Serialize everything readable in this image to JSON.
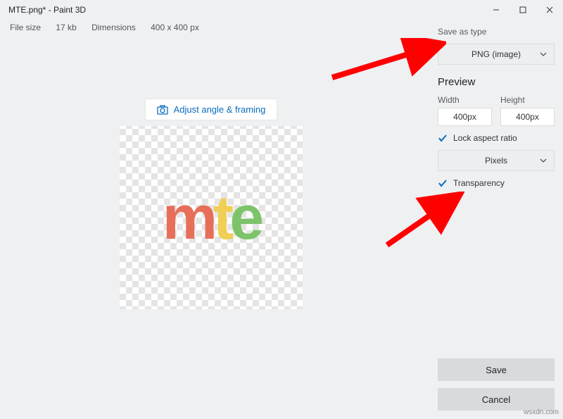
{
  "window": {
    "title": "MTE.png* - Paint 3D",
    "file_size_label": "File size",
    "file_size_value": "17 kb",
    "dimensions_label": "Dimensions",
    "dimensions_value": "400 x 400 px"
  },
  "main": {
    "adjust_label": "Adjust angle & framing",
    "logo_m": "m",
    "logo_t": "t",
    "logo_e": "e"
  },
  "sidebar": {
    "save_as_type_label": "Save as type",
    "file_type": "PNG (image)",
    "preview_label": "Preview",
    "width_label": "Width",
    "height_label": "Height",
    "width_value": "400px",
    "height_value": "400px",
    "lock_aspect_label": "Lock aspect ratio",
    "units": "Pixels",
    "transparency_label": "Transparency",
    "save_label": "Save",
    "cancel_label": "Cancel"
  },
  "watermark": "wsxdn.com"
}
